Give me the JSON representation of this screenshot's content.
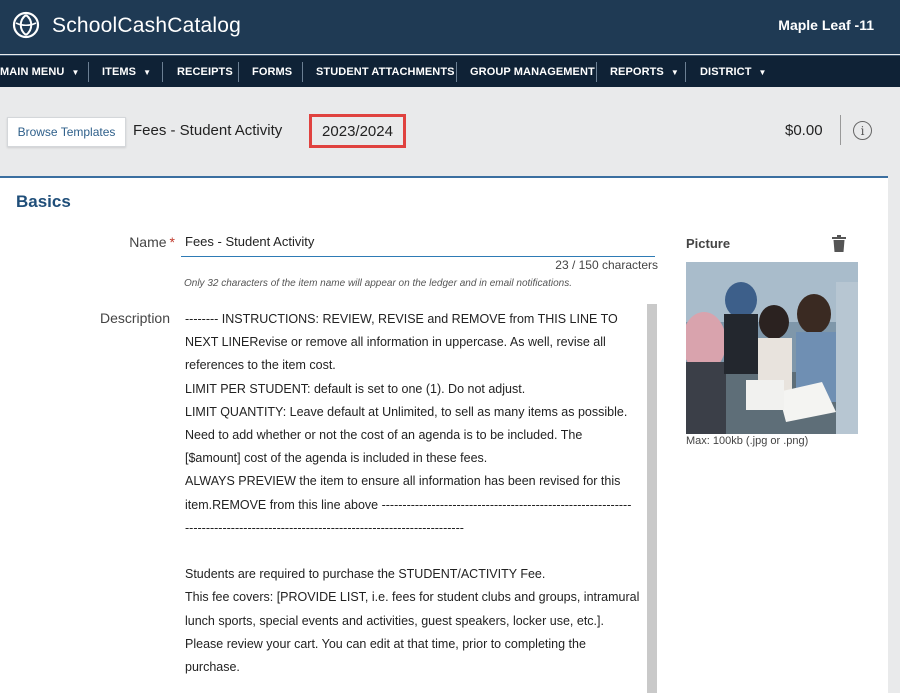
{
  "header": {
    "app_title": "SchoolCashCatalog",
    "school_name": "Maple Leaf -11"
  },
  "nav": {
    "items": [
      {
        "label": "MAIN MENU",
        "has_dropdown": true
      },
      {
        "label": "ITEMS",
        "has_dropdown": true
      },
      {
        "label": "RECEIPTS",
        "has_dropdown": false
      },
      {
        "label": "FORMS",
        "has_dropdown": false
      },
      {
        "label": "STUDENT ATTACHMENTS",
        "has_dropdown": false
      },
      {
        "label": "GROUP MANAGEMENT",
        "has_dropdown": false
      },
      {
        "label": "REPORTS",
        "has_dropdown": true
      },
      {
        "label": "DISTRICT",
        "has_dropdown": true
      }
    ],
    "caret": "▼"
  },
  "toolbar": {
    "browse_label": "Browse Templates",
    "item_title": "Fees - Student Activity",
    "school_year": "2023/2024",
    "total": "$0.00",
    "info_glyph": "i",
    "highlight_color": "#e0423f"
  },
  "basics": {
    "section_title": "Basics",
    "name_label": "Name",
    "required_mark": "*",
    "name_value": "Fees - Student Activity",
    "char_count": "23 / 150  characters",
    "name_hint": "Only 32 characters of the item name will appear on the ledger and in email notifications.",
    "description_label": "Description",
    "description_text": "-------- INSTRUCTIONS: REVIEW, REVISE and REMOVE from THIS LINE TO NEXT LINERevise or remove all information in uppercase. As well, revise all references to the item cost.\nLIMIT PER STUDENT: default is set to one (1). Do not adjust.\nLIMIT QUANTITY: Leave default at Unlimited, to sell as many items as possible. Need to add whether or not the cost of an agenda is to be included. The [$amount] cost of the agenda is included in these fees.\nALWAYS PREVIEW the item to ensure all information has been revised for this item.REMOVE from this line above ------------------------------------------------------------\n-------------------------------------------------------------------\n\nStudents are required to purchase the STUDENT/ACTIVITY Fee.\nThis fee covers: [PROVIDE LIST, i.e. fees for student clubs and groups, intramural lunch sports, special events and activities, guest speakers, locker use, etc.].\nPlease review your cart. You can edit at that time, prior to completing the purchase.",
    "picture_label": "Picture",
    "picture_caption": "Max: 100kb (.jpg or .png)"
  },
  "colors": {
    "header_bg": "#1f3a54",
    "nav_bg": "#0f2236",
    "accent": "#1f4e79",
    "input_underline": "#2e7bb5"
  }
}
